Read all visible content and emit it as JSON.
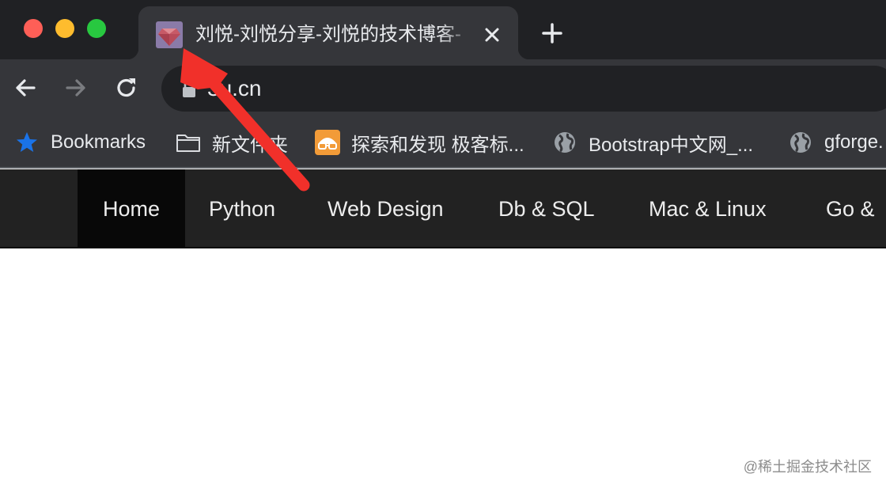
{
  "browser": {
    "tab": {
      "title": "刘悦-刘悦分享-刘悦的技术博客-",
      "favicon": "ruby-gem-icon"
    },
    "address_bar": {
      "url": "3u.cn"
    },
    "bookmarks": [
      {
        "label": "Bookmarks",
        "icon": "star-icon"
      },
      {
        "label": "新文件夹",
        "icon": "folder-icon"
      },
      {
        "label": "探索和发现 极客标...",
        "icon": "geek-glasses-icon"
      },
      {
        "label": "Bootstrap中文网_...",
        "icon": "globe-icon"
      },
      {
        "label": "gforge.",
        "icon": "globe-icon"
      }
    ],
    "colors": {
      "titlebar": "#202124",
      "toolbar": "#35363a",
      "accent_star": "#1a73e8",
      "annotation_arrow": "#f1302a"
    }
  },
  "site_nav": {
    "items": [
      {
        "label": "Home",
        "active": true
      },
      {
        "label": "Python"
      },
      {
        "label": "Web Design"
      },
      {
        "label": "Db & SQL"
      },
      {
        "label": "Mac & Linux"
      },
      {
        "label": "Go &"
      }
    ]
  },
  "watermark": "@稀土掘金技术社区"
}
